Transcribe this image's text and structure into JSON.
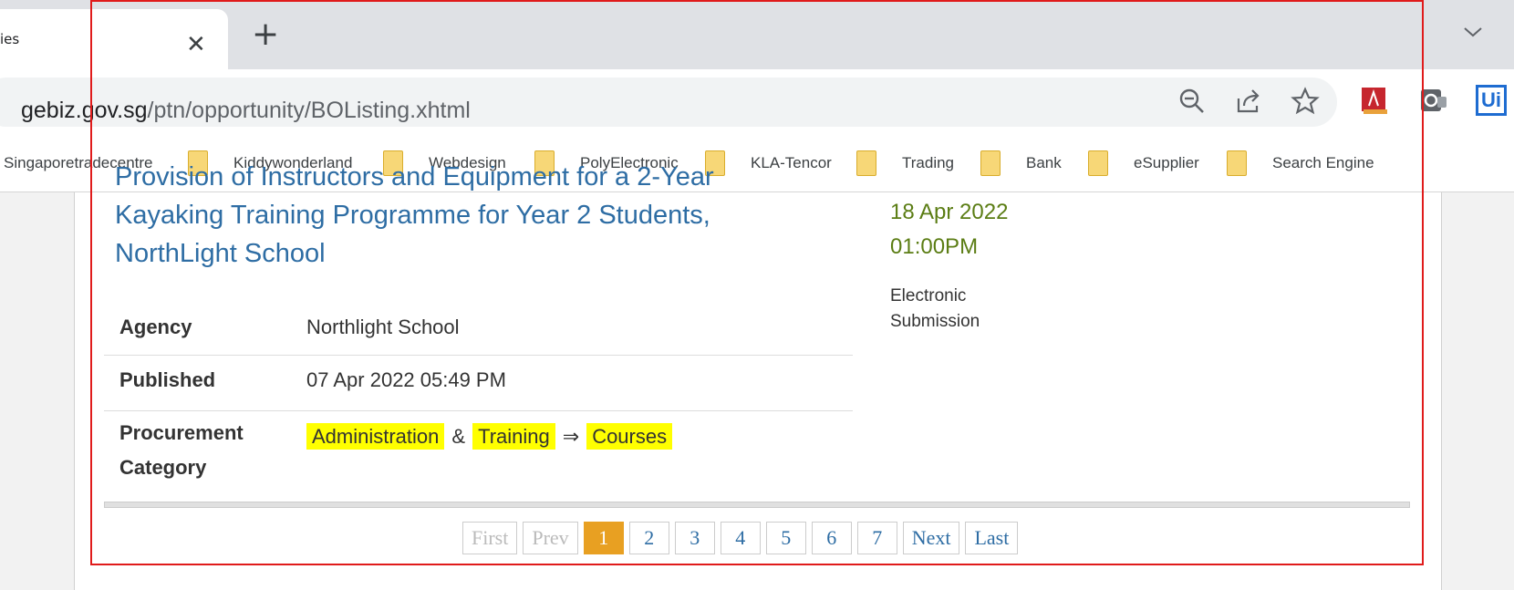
{
  "browser": {
    "tab_title": "ies",
    "url_domain": "gebiz.gov.sg",
    "url_path": "/ptn/opportunity/BOListing.xhtml",
    "ext3_label": "Ui"
  },
  "bookmarks": [
    {
      "label": "Singaporetradecentre"
    },
    {
      "label": "Kiddywonderland"
    },
    {
      "label": "Webdesign"
    },
    {
      "label": "PolyElectronic"
    },
    {
      "label": "KLA-Tencor"
    },
    {
      "label": "Trading"
    },
    {
      "label": "Bank"
    },
    {
      "label": "eSupplier"
    },
    {
      "label": "Search Engine"
    }
  ],
  "listing": {
    "title_line1": "Provision of Instructors and Equipment for a 2-Year",
    "title_line2": "Kayaking Training Programme for Year 2 Students,",
    "title_line3": "NorthLight School",
    "closing_date": "18 Apr 2022",
    "closing_time": "01:00PM",
    "submission_line1": "Electronic",
    "submission_line2": "Submission",
    "agency_label": "Agency",
    "agency_value": "Northlight School",
    "published_label": "Published",
    "published_value": "07 Apr 2022 05:49 PM",
    "category_label_line1": "Procurement",
    "category_label_line2": "Category",
    "category_1": "Administration",
    "category_sep_1": "&",
    "category_2": "Training",
    "category_sep_2": "⇒",
    "category_3": "Courses"
  },
  "pagination": {
    "first": "First",
    "prev": "Prev",
    "pages": [
      "1",
      "2",
      "3",
      "4",
      "5",
      "6",
      "7"
    ],
    "current": "1",
    "next": "Next",
    "last": "Last"
  },
  "colors": {
    "link": "#2e6da4",
    "date": "#5b7d14",
    "highlight": "#ffff00",
    "active_page": "#e8a022",
    "frame": "#e01b1b"
  }
}
